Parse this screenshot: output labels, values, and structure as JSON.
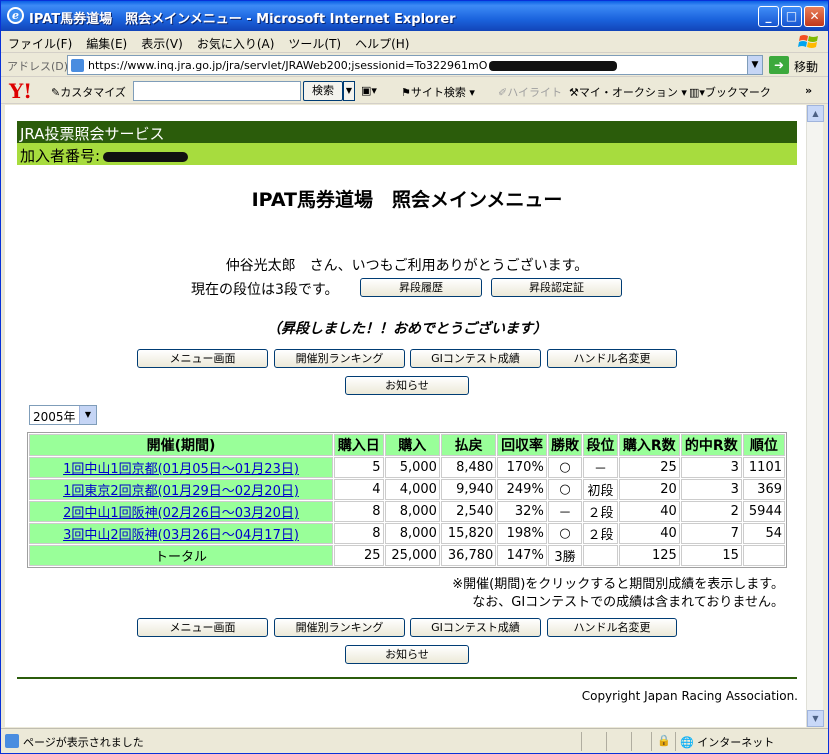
{
  "window": {
    "title": "IPAT馬券道場　照会メインメニュー - Microsoft Internet Explorer",
    "controls": {
      "minimize": "_",
      "maximize": "□",
      "close": "✕"
    }
  },
  "menubar": {
    "items": [
      "ファイル(F)",
      "編集(E)",
      "表示(V)",
      "お気に入り(A)",
      "ツール(T)",
      "ヘルプ(H)"
    ]
  },
  "addressbar": {
    "label": "アドレス(D)",
    "url": "https://www.inq.jra.go.jp/jra/servlet/JRAWeb200;jsessionid=To322961mO",
    "go_label": "移動"
  },
  "yahoo_toolbar": {
    "logo": "Y!",
    "customize": "カスタマイズ",
    "search_button": "検索",
    "site_search": "サイト検索",
    "highlight": "ハイライト",
    "my_auction": "マイ・オークション",
    "bookmark": "ブックマーク",
    "more": "»"
  },
  "page": {
    "service_name": "JRA投票照会サービス",
    "member_label": "加入者番号:",
    "main_title": "IPAT馬券道場　照会メインメニュー",
    "greeting": "仲谷光太郎　さん、いつもご利用ありがとうございます。",
    "rank_text": "現在の段位は3段です。",
    "rank_history_button": "昇段履歴",
    "rank_cert_button": "昇段認定証",
    "congrats": "（昇段しました！！おめでとうございます）",
    "nav_buttons": {
      "menu": "メニュー画面",
      "ranking": "開催別ランキング",
      "contest": "GIコンテスト成績",
      "handle": "ハンドル名変更",
      "notice": "お知らせ"
    },
    "year_select": "2005年",
    "table": {
      "headers": [
        "開催(期間)",
        "購入日",
        "購入",
        "払戻",
        "回収率",
        "勝敗",
        "段位",
        "購入R数",
        "的中R数",
        "順位"
      ],
      "rows": [
        {
          "period": "1回中山1回京都(01月05日～01月23日)",
          "days": "5",
          "purchase": "5,000",
          "payout": "8,480",
          "rate": "170%",
          "result": "○",
          "rank": "－",
          "races": "25",
          "hits": "3",
          "position": "1101"
        },
        {
          "period": "1回東京2回京都(01月29日～02月20日)",
          "days": "4",
          "purchase": "4,000",
          "payout": "9,940",
          "rate": "249%",
          "result": "○",
          "rank": "初段",
          "races": "20",
          "hits": "3",
          "position": "369"
        },
        {
          "period": "2回中山1回阪神(02月26日～03月20日)",
          "days": "8",
          "purchase": "8,000",
          "payout": "2,540",
          "rate": "32%",
          "result": "－",
          "rank": "２段",
          "races": "40",
          "hits": "2",
          "position": "5944"
        },
        {
          "period": "3回中山2回阪神(03月26日～04月17日)",
          "days": "8",
          "purchase": "8,000",
          "payout": "15,820",
          "rate": "198%",
          "result": "○",
          "rank": "２段",
          "races": "40",
          "hits": "7",
          "position": "54"
        }
      ],
      "total": {
        "label": "トータル",
        "days": "25",
        "purchase": "25,000",
        "payout": "36,780",
        "rate": "147%",
        "result": "3勝",
        "rank": "",
        "races": "125",
        "hits": "15",
        "position": ""
      }
    },
    "note1": "※開催(期間)をクリックすると期間別成績を表示します。",
    "note2": "なお、GIコンテストでの成績は含まれておりません。",
    "copyright": "Copyright Japan Racing Association."
  },
  "statusbar": {
    "message": "ページが表示されました",
    "zone": "インターネット"
  }
}
